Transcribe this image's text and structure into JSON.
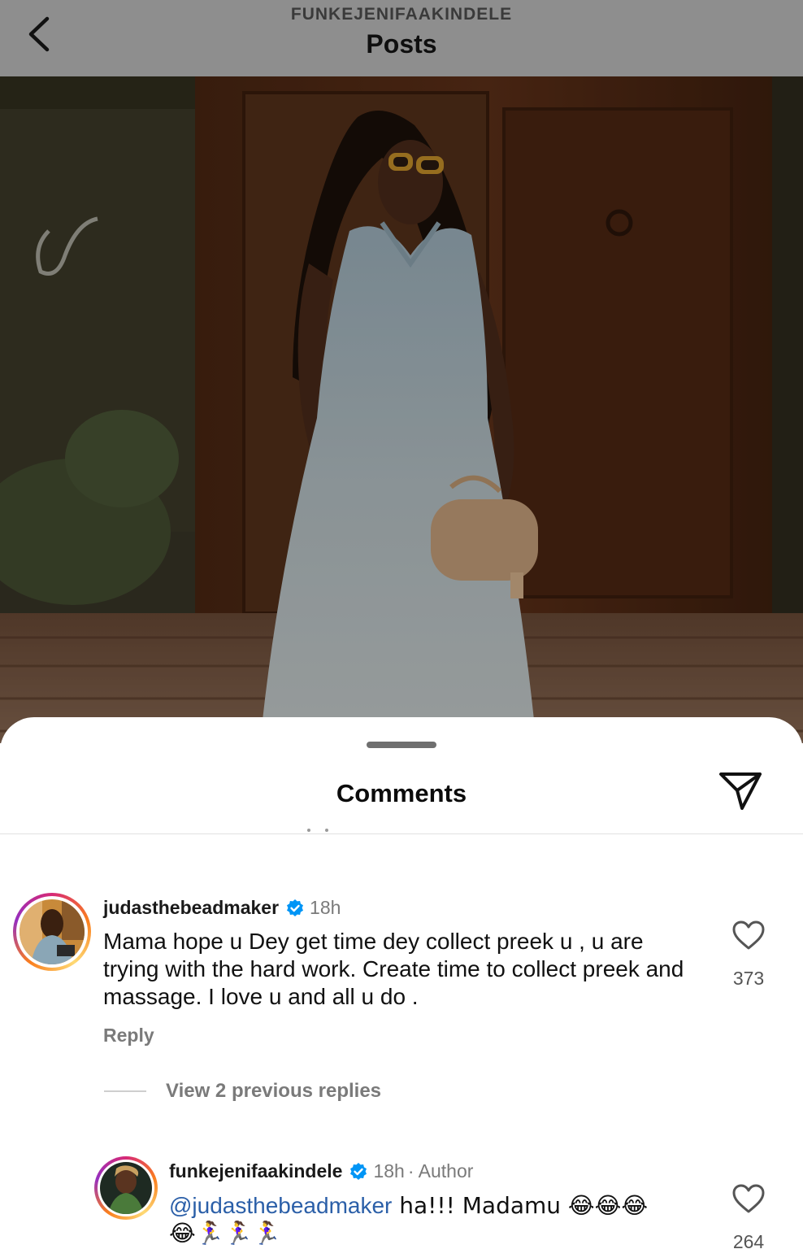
{
  "header": {
    "account": "FUNKEJENIFAAKINDELE",
    "title": "Posts",
    "back_icon": "chevron-left-icon"
  },
  "post": {
    "image": "woman-in-pale-blue-halter-dress-with-sunglasses-and-handbag"
  },
  "comments_sheet": {
    "title": "Comments",
    "share_icon": "paper-plane-icon",
    "comments": [
      {
        "username": "judasthebeadmaker",
        "verified": true,
        "time": "18h",
        "text": "Mama hope u Dey get time dey collect preek u , u are trying with the hard work. Create time to collect preek and massage. I love u and all u do .",
        "reply_label": "Reply",
        "likes": "373",
        "view_replies": "View 2 previous replies"
      },
      {
        "username": "funkejenifaakindele",
        "verified": true,
        "time": "18h",
        "author_tag": "· Author",
        "mention": "@judasthebeadmaker",
        "text": " ha!!! Madamu 😂😂😂",
        "text_line2": "😂🏃‍♀️🏃‍♀️🏃‍♀️",
        "likes": "264"
      }
    ]
  },
  "colors": {
    "header_bg": "#8e8e8e",
    "verified": "#0095f6",
    "mention": "#2b5fa8",
    "muted_text": "#7a7a7a"
  }
}
